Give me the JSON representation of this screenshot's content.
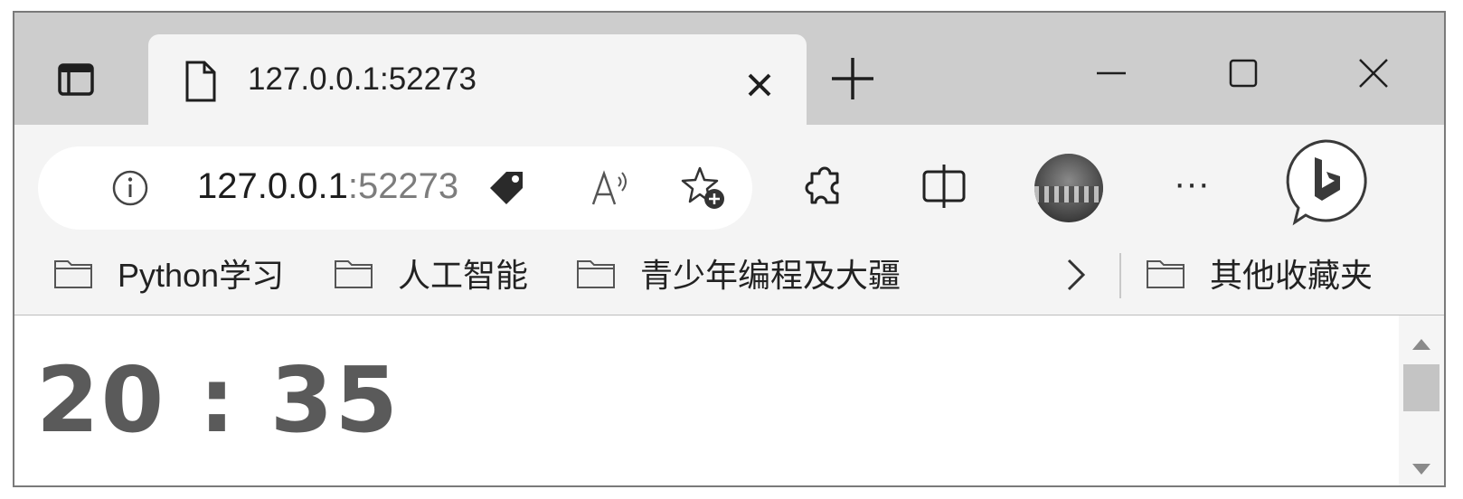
{
  "tab": {
    "title": "127.0.0.1:52273"
  },
  "address_bar": {
    "host": "127.0.0.1",
    "port": ":52273"
  },
  "favorites": {
    "items": [
      {
        "label": "Python学习"
      },
      {
        "label": "人工智能"
      },
      {
        "label": "青少年编程及大疆"
      }
    ],
    "other_label": "其他收藏夹"
  },
  "page": {
    "clock_text": "20 : 35"
  },
  "icons": {
    "workspaces": "tab-actions-icon",
    "favicon": "page-icon",
    "close_tab": "close-icon",
    "new_tab": "plus-icon",
    "minimize": "minimize-icon",
    "maximize": "maximize-icon",
    "close_window": "close-icon",
    "site_info": "info-icon",
    "tag": "tag-icon",
    "read_aloud": "read-aloud-icon",
    "add_favorite": "star-add-icon",
    "extensions": "puzzle-icon",
    "split_screen": "split-screen-icon",
    "more": "more-icon",
    "bing": "bing-chat-icon",
    "folder": "folder-icon",
    "overflow": "chevron-right-icon"
  }
}
